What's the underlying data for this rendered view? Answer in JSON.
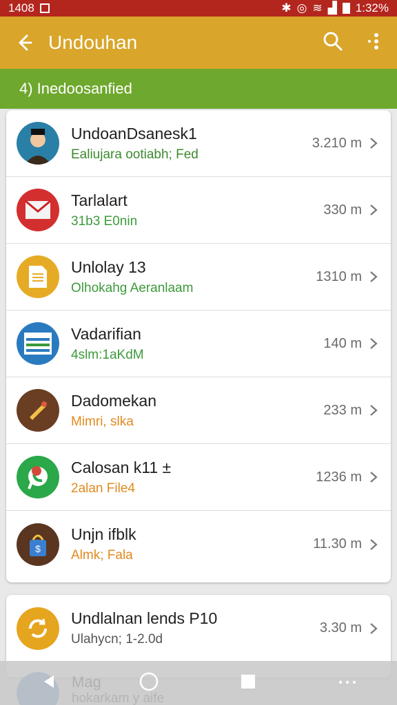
{
  "status_bar": {
    "time_left": "1408",
    "time_right": "1:32%"
  },
  "app_bar": {
    "title": "Undouhan"
  },
  "banner": {
    "text": "4) Inedoosanfied"
  },
  "rows": [
    {
      "name": "UndoanDsanesk1",
      "sub": "Ealiujara ootiabh; Fed",
      "sub_color": "#3c8a2e",
      "meta": "3.210 m",
      "icon": "avatar-icon",
      "icon_bg": "#2a7fa6"
    },
    {
      "name": "Tarlalart",
      "sub": "31b3 E0nin",
      "sub_color": "#3c9a3a",
      "meta": "330 m",
      "icon": "mail-icon",
      "icon_bg": "#d42f2f"
    },
    {
      "name": "Unlolay 13",
      "sub": "Olhokahg Aeranlaam",
      "sub_color": "#3c9a3a",
      "meta": "1310 m",
      "icon": "document-icon",
      "icon_bg": "#e6ab25"
    },
    {
      "name": "Vadarifian",
      "sub": "4slm:1aKdM",
      "sub_color": "#3c9a3a",
      "meta": "140 m",
      "icon": "window-icon",
      "icon_bg": "#2a7ac0"
    },
    {
      "name": "Dadomekan",
      "sub": "Mimri, slka",
      "sub_color": "#e08a1e",
      "meta": "233 m",
      "icon": "pencil-icon",
      "icon_bg": "#6a3e23"
    },
    {
      "name": "Calosan k11 ±",
      "sub": "2alan File4",
      "sub_color": "#e08a1e",
      "meta": "1236 m",
      "icon": "whatsapp-icon",
      "icon_bg": "#2aa84a"
    },
    {
      "name": "Unjn ifblk",
      "sub": "Almk; Fala",
      "sub_color": "#e08a1e",
      "meta": "11.30 m",
      "icon": "shopping-bag-icon",
      "icon_bg": "#5a3520"
    }
  ],
  "second_card": {
    "name": "Undlalnan lends P10",
    "sub": "Ulahycn; 1-2.0d",
    "meta": "3.30 m",
    "icon": "sync-icon",
    "icon_bg": "#e6a51e"
  },
  "peek_row": {
    "name": "Mag",
    "sub": "hokarkam y aife"
  }
}
